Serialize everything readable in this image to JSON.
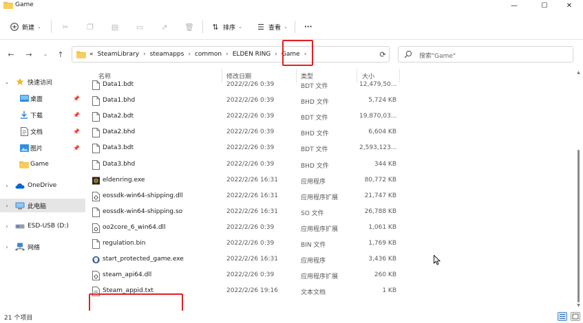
{
  "window": {
    "title": "Game",
    "controls": {
      "minimize": "—",
      "maximize": "☐",
      "close": "✕"
    }
  },
  "toolbar": {
    "new_label": "新建",
    "sort_label": "排序",
    "view_label": "查看",
    "more_label": "···"
  },
  "address": {
    "prefix": "«",
    "crumbs": [
      "SteamLibrary",
      "steamapps",
      "common",
      "ELDEN RING",
      "Game"
    ],
    "separator": "›"
  },
  "search": {
    "placeholder": "搜索\"Game\""
  },
  "sidebar": {
    "items": [
      {
        "label": "快速访问",
        "icon": "star-icon",
        "expanded": true
      },
      {
        "label": "桌面",
        "icon": "desktop-icon",
        "pinned": true
      },
      {
        "label": "下载",
        "icon": "download-icon",
        "pinned": true
      },
      {
        "label": "文档",
        "icon": "document-icon",
        "pinned": true
      },
      {
        "label": "图片",
        "icon": "pictures-icon",
        "pinned": true
      },
      {
        "label": "Game",
        "icon": "folder-icon",
        "pinned": false
      },
      {
        "label": "OneDrive",
        "icon": "cloud-icon",
        "expanded": false
      },
      {
        "label": "此电脑",
        "icon": "computer-icon",
        "expanded": false,
        "selected": true
      },
      {
        "label": "ESD-USB (D:)",
        "icon": "drive-icon",
        "expanded": false
      },
      {
        "label": "网络",
        "icon": "network-icon",
        "expanded": false
      }
    ],
    "colors": {
      "star": "#f2b821",
      "folder": "#f4c24a",
      "desktop": "#2e8be0",
      "onedrive": "#0a64d6"
    }
  },
  "columns": {
    "name": "名称",
    "date": "修改日期",
    "type": "类型",
    "size": "大小"
  },
  "files": [
    {
      "name": "Data1.bdt",
      "date": "2022/2/26 0:39",
      "type": "BDT 文件",
      "size": "12,479,50...",
      "icon": "file-icon"
    },
    {
      "name": "Data1.bhd",
      "date": "2022/2/26 0:39",
      "type": "BHD 文件",
      "size": "5,724 KB",
      "icon": "file-icon"
    },
    {
      "name": "Data2.bdt",
      "date": "2022/2/26 0:39",
      "type": "BDT 文件",
      "size": "19,870,03...",
      "icon": "file-icon"
    },
    {
      "name": "Data2.bhd",
      "date": "2022/2/26 0:39",
      "type": "BHD 文件",
      "size": "6,604 KB",
      "icon": "file-icon"
    },
    {
      "name": "Data3.bdt",
      "date": "2022/2/26 0:39",
      "type": "BDT 文件",
      "size": "2,593,123...",
      "icon": "file-icon"
    },
    {
      "name": "Data3.bhd",
      "date": "2022/2/26 0:39",
      "type": "BHD 文件",
      "size": "344 KB",
      "icon": "file-icon"
    },
    {
      "name": "eldenring.exe",
      "date": "2022/2/26 16:31",
      "type": "应用程序",
      "size": "80,772 KB",
      "icon": "app-icon"
    },
    {
      "name": "eossdk-win64-shipping.dll",
      "date": "2022/2/26 16:31",
      "type": "应用程序扩展",
      "size": "21,747 KB",
      "icon": "dll-icon"
    },
    {
      "name": "eossdk-win64-shipping.so",
      "date": "2022/2/26 16:31",
      "type": "SO 文件",
      "size": "26,788 KB",
      "icon": "file-icon"
    },
    {
      "name": "oo2core_6_win64.dll",
      "date": "2022/2/26 0:39",
      "type": "应用程序扩展",
      "size": "1,061 KB",
      "icon": "dll-icon"
    },
    {
      "name": "regulation.bin",
      "date": "2022/2/26 0:39",
      "type": "BIN 文件",
      "size": "1,769 KB",
      "icon": "file-icon"
    },
    {
      "name": "start_protected_game.exe",
      "date": "2022/2/26 16:31",
      "type": "应用程序",
      "size": "3,436 KB",
      "icon": "shield-app-icon"
    },
    {
      "name": "steam_api64.dll",
      "date": "2022/2/26 0:39",
      "type": "应用程序扩展",
      "size": "260 KB",
      "icon": "dll-icon"
    },
    {
      "name": "Steam_appid.txt",
      "date": "2022/2/26 19:16",
      "type": "文本文档",
      "size": "1 KB",
      "icon": "text-file-icon"
    }
  ],
  "status": {
    "count": "21 个项目"
  },
  "highlight_color": "#e02020"
}
